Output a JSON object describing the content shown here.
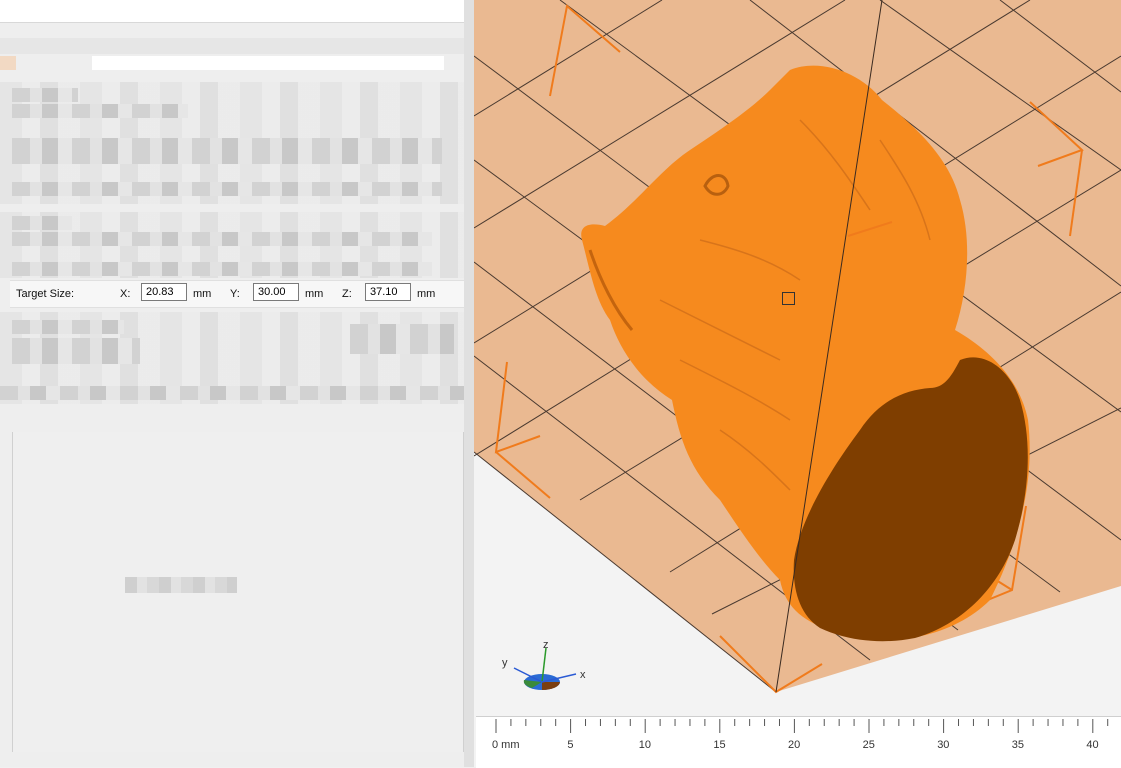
{
  "target_size": {
    "label": "Target Size:",
    "x": {
      "label": "X:",
      "value": "20.83",
      "unit": "mm"
    },
    "y": {
      "label": "Y:",
      "value": "30.00",
      "unit": "mm"
    },
    "z": {
      "label": "Z:",
      "value": "37.10",
      "unit": "mm"
    }
  },
  "axis_gizmo": {
    "x": "x",
    "y": "y",
    "z": "z"
  },
  "ruler": {
    "ticks": [
      "0 mm",
      "5",
      "10",
      "15",
      "20",
      "25",
      "30",
      "35",
      "40"
    ]
  },
  "colors": {
    "model_orange": "#f68a1e",
    "model_cut_face": "#7f3e00",
    "build_plate": "#eab991",
    "bounding_box": "#f07b1c"
  }
}
